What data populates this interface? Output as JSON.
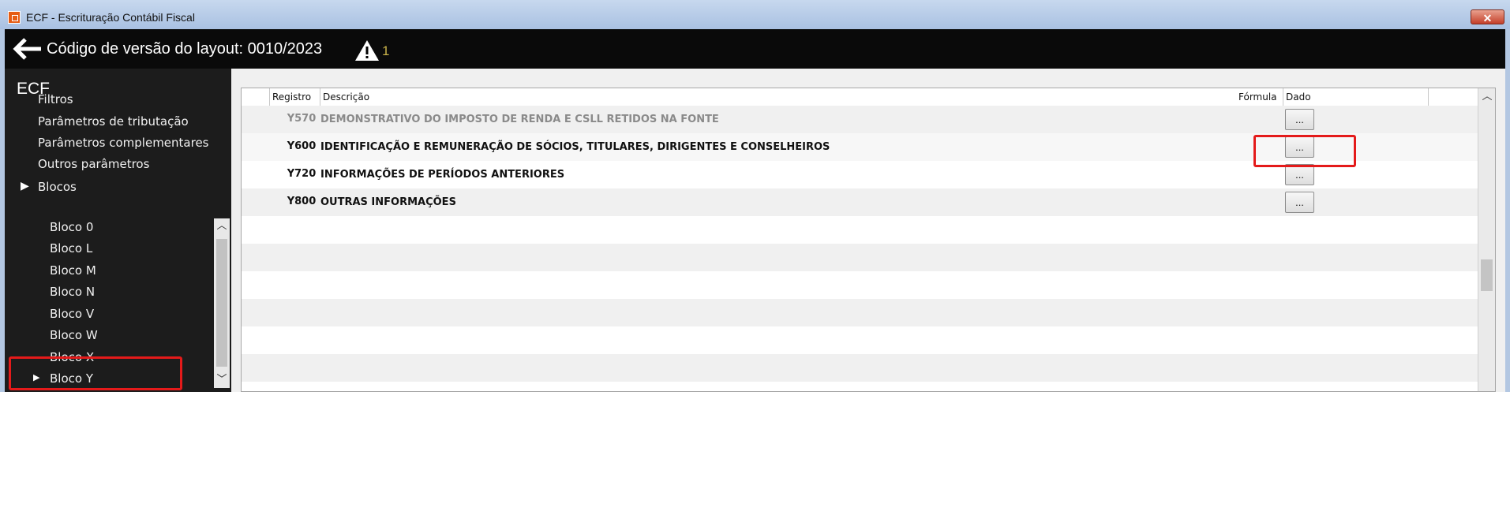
{
  "window": {
    "title": "ECF - Escrituração Contábil Fiscal",
    "close_label": "✕"
  },
  "header": {
    "title": "Código de versão do layout: 0010/2023",
    "warning_count": "1"
  },
  "sidebar": {
    "title": "ECF",
    "items": [
      {
        "label": "Filtros"
      },
      {
        "label": "Parâmetros de tributação"
      },
      {
        "label": "Parâmetros complementares"
      },
      {
        "label": "Outros parâmetros"
      }
    ],
    "blocos": {
      "label": "Blocos",
      "children": [
        {
          "label": "Bloco 0"
        },
        {
          "label": "Bloco L"
        },
        {
          "label": "Bloco M"
        },
        {
          "label": "Bloco N"
        },
        {
          "label": "Bloco V"
        },
        {
          "label": "Bloco W"
        },
        {
          "label": "Bloco X"
        },
        {
          "label": "Bloco Y",
          "selected": true
        }
      ]
    }
  },
  "grid": {
    "columns": {
      "registro": "Registro",
      "descricao": "Descrição",
      "formula": "Fórmula",
      "dado": "Dado"
    },
    "rows": [
      {
        "code": "Y570",
        "desc": "DEMONSTRATIVO DO IMPOSTO DE RENDA E CSLL RETIDOS NA FONTE",
        "button": "...",
        "dimmed": true
      },
      {
        "code": "Y600",
        "desc": "IDENTIFICAÇÃO E REMUNERAÇÃO DE SÓCIOS, TITULARES, DIRIGENTES E CONSELHEIROS",
        "button": "..."
      },
      {
        "code": "Y720",
        "desc": "INFORMAÇÕES DE PERÍODOS ANTERIORES",
        "button": "..."
      },
      {
        "code": "Y800",
        "desc": "OUTRAS INFORMAÇÕES",
        "button": "..."
      }
    ]
  },
  "colors": {
    "header_bg": "#0a0a0a",
    "sidebar_bg": "#1c1c1c",
    "highlight": "#e41a1a"
  }
}
